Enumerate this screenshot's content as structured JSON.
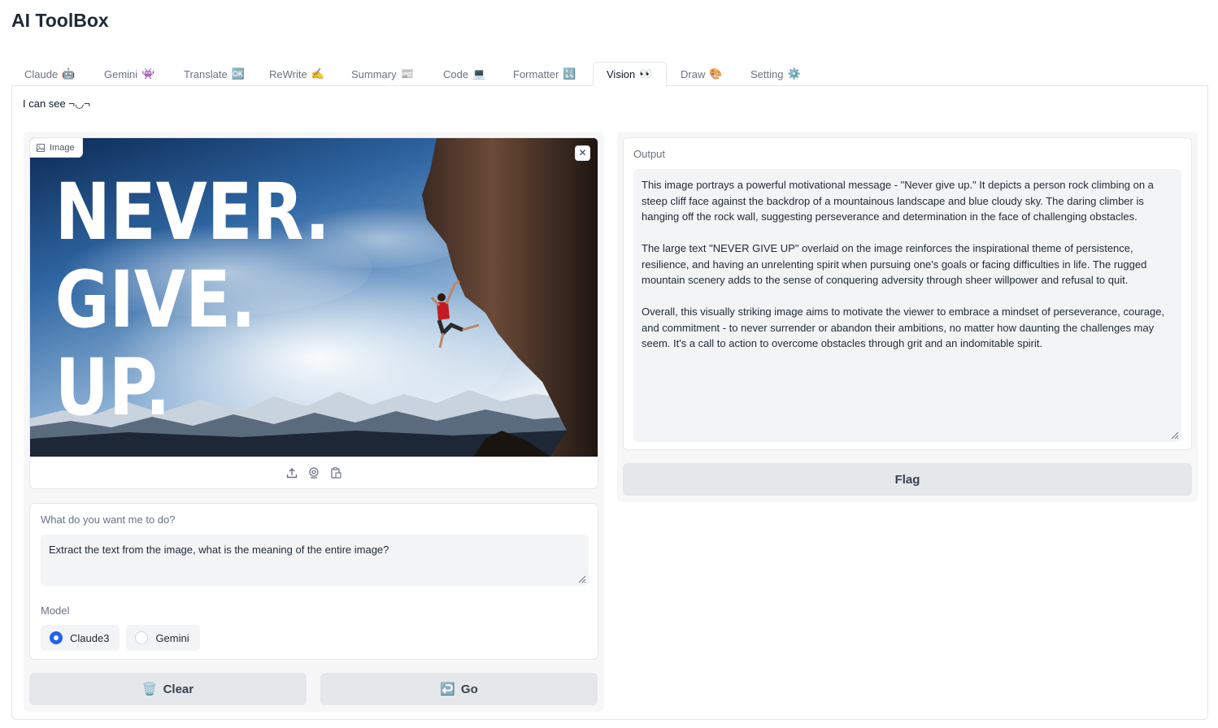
{
  "app": {
    "title": "AI ToolBox"
  },
  "tabs": [
    {
      "label": "Claude",
      "emoji": "🤖"
    },
    {
      "label": "Gemini",
      "emoji": "👾"
    },
    {
      "label": "Translate",
      "emoji": "🆗"
    },
    {
      "label": "ReWrite",
      "emoji": "✍️"
    },
    {
      "label": "Summary",
      "emoji": "📰"
    },
    {
      "label": "Code",
      "emoji": "💻"
    },
    {
      "label": "Formatter",
      "emoji": "🔣"
    },
    {
      "label": "Vision",
      "emoji": "👀"
    },
    {
      "label": "Draw",
      "emoji": "🎨"
    },
    {
      "label": "Setting",
      "emoji": "⚙️"
    }
  ],
  "active_tab": "Vision",
  "vision": {
    "description": "I can see ¬◡¬",
    "image": {
      "label": "Image",
      "overlay_text": [
        "NEVER.",
        "GIVE.",
        "UP."
      ],
      "tools": [
        "upload-icon",
        "webcam-icon",
        "clipboard-icon"
      ]
    },
    "prompt": {
      "label": "What do you want me to do?",
      "value": "Extract the text from the image, what is the meaning of the entire image?"
    },
    "model": {
      "label": "Model",
      "options": [
        "Claude3",
        "Gemini"
      ],
      "selected": "Claude3"
    },
    "buttons": {
      "clear_label": "Clear",
      "clear_icon": "🗑️",
      "go_label": "Go",
      "go_icon": "↩️"
    },
    "output": {
      "label": "Output",
      "paragraphs": [
        "This image portrays a powerful motivational message - \"Never give up.\" It depicts a person rock climbing on a steep cliff face against the backdrop of a mountainous landscape and blue cloudy sky. The daring climber is hanging off the rock wall, suggesting perseverance and determination in the face of challenging obstacles.",
        "The large text \"NEVER GIVE UP\" overlaid on the image reinforces the inspirational theme of persistence, resilience, and having an unrelenting spirit when pursuing one's goals or facing difficulties in life. The rugged mountain scenery adds to the sense of conquering adversity through sheer willpower and refusal to quit.",
        "Overall, this visually striking image aims to motivate the viewer to embrace a mindset of perseverance, courage, and commitment - to never surrender or abandon their ambitions, no matter how daunting the challenges may seem. It's a call to action to overcome obstacles through grit and an indomitable spirit."
      ]
    },
    "flag_label": "Flag"
  },
  "colors": {
    "accent": "#2563eb",
    "button_bg": "#e5e7eb",
    "field_bg": "#f3f4f6"
  }
}
